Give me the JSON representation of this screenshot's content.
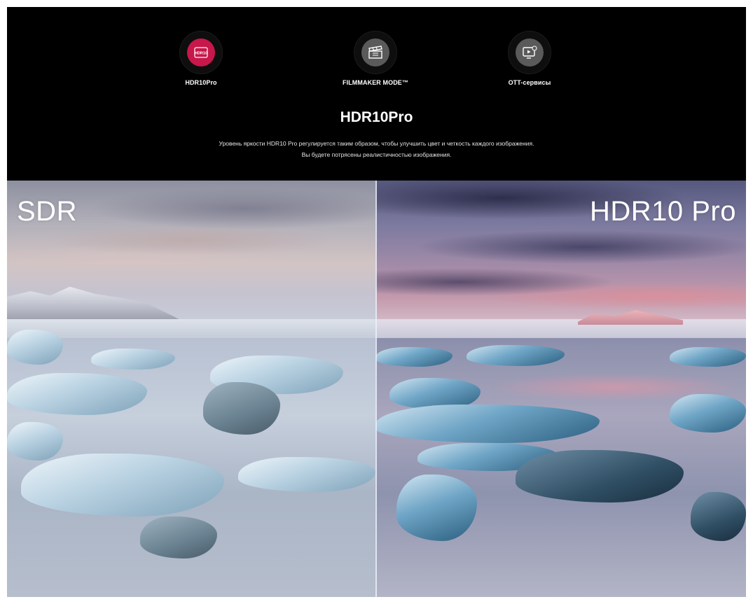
{
  "tabs": [
    {
      "id": "hdr10pro",
      "label": "HDR10Pro",
      "icon": "hdr10-badge-icon",
      "icon_text": "HDR10",
      "active": true,
      "accent": "#c8174a"
    },
    {
      "id": "filmmaker",
      "label": "FILMMAKER MODE™",
      "icon": "clapperboard-icon",
      "active": false
    },
    {
      "id": "ott",
      "label": "OTT-сервисы",
      "icon": "tv-play-icon",
      "active": false
    }
  ],
  "section": {
    "title": "HDR10Pro",
    "description_line1": "Уровень яркости HDR10 Pro регулируется таким образом, чтобы улучшить цвет и четкость каждого изображения.",
    "description_line2": "Вы будете потрясены реалистичностью изображения."
  },
  "comparison": {
    "left_label": "SDR",
    "right_label": "HDR10 Pro"
  },
  "colors": {
    "background": "#000000",
    "accent": "#c8174a",
    "text": "#ffffff"
  }
}
